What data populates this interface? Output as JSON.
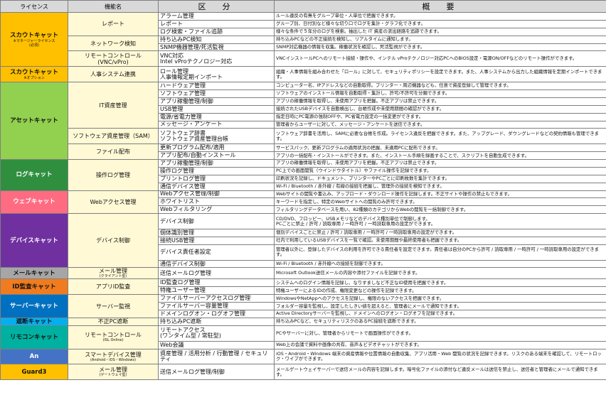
{
  "header": {
    "license": "ライセンス",
    "function": "機能名",
    "division": "区　分",
    "overview": "概　要"
  },
  "groups": [
    {
      "license": "スカウトキャット",
      "license_sub": "※マネージャーライセンス\n(必須)",
      "color": "#ffc000",
      "text_color": "#111111",
      "rows": [
        {
          "func": "レポート",
          "span": 3,
          "div": "アラーム管理",
          "ov": "ルール違反の有無をグループ単位・人単位で把握できます。"
        },
        {
          "div": "レポート",
          "ov": "グループ別、日付別など様々な切り口でログを集計・グラフ化できます。"
        },
        {
          "div": "ログ検索・ファイル追跡",
          "ov": "様々な条件で５年分のログを検索。抽出した IT 資産の流出経路を追跡できます。"
        },
        {
          "func": "ネットワーク検知",
          "span": 2,
          "div": "持ち込みPC検知",
          "ov": "持ち込みPCなどの不正接続を検知し、リアルタイムに通知します。"
        },
        {
          "div": "SNMP機器管理/死活監視",
          "ov": "SNMP対応機器の情報を収集。稼働状況を確認し、死活監視ができます。"
        },
        {
          "func": "リモートコントロール\n(VNC/vPro)",
          "span": 1,
          "div": "VNC対応\nIntel vProテクノロジー対応",
          "ov": "VNCインストールPCへのリモート接続・操作や、インテル vProテクノロジー対応PCへのBIOS設定・電源ON/OFFなどのリモート操作ができます。"
        }
      ]
    },
    {
      "license": "スカウトキャット",
      "license_sub": "※オプション",
      "color": "#ffc000",
      "text_color": "#111111",
      "rows": [
        {
          "func": "人事システム連携",
          "span": 1,
          "div": "ロール管理\n人事情報定期インポート",
          "ov": "組織・人事情報を組み合わせた「ロール」に対して、セキュリティポリシーを設定できます。また、人事システムから出力した組織情報を定期インポートできます。"
        }
      ]
    },
    {
      "license": "アセットキャット",
      "license_sub": "",
      "color": "#92d050",
      "text_color": "#111111",
      "rows": [
        {
          "func": "IT資産管理",
          "span": 6,
          "div": "ハードウェア管理",
          "ov": "コンピューター名、IPアドレスなどの自動取得。プリンター・周辺機器なども、任意で資産登録して管理できます。"
        },
        {
          "div": "ソフトウェア管理",
          "ov": "ソフトウェアのインストール情報を自動取得・集計し、許可/不許可を分類できます。"
        },
        {
          "div": "アプリ稼働管理/制御",
          "ov": "アプリの稼働情報を取得し、未使用アプリを把握。不正アプリは禁止できます。"
        },
        {
          "div": "USB管理",
          "ov": "接続されたUSBデバイスを自動検出し、台帳作成や未使用期間の確認ができます。"
        },
        {
          "div": "電源/省電力管理",
          "ov": "指定日時にPC電源の強制OFFや、PC省電力設定の一括変更ができます。"
        },
        {
          "div": "メッセージ・アンケート",
          "ov": "管理者からユーザーに対して、メッセージ・アンケートを送信できます。"
        },
        {
          "func": "ソフトウェア資産管理（SAM）",
          "span": 1,
          "div": "ソフトウェア辞書\nソフトウェア資産管理台帳",
          "ov": "ソフトウェア辞書を活用し、SAMに必要な台帳を作成。ライセンス違反を把握できます。また、アップグレード、ダウングレードなどの契約情報も管理できます。"
        },
        {
          "func": "ファイル配布",
          "span": 2,
          "div": "更新プログラム配布/適用",
          "ov": "サービスパック、更新プログラムの適用状況の把握、未適用PCに配布できます。"
        },
        {
          "div": "アプリ配布/自動インストール",
          "ov": "アプリの一括配布・インストールができます。また、インストール手順を録画することで、スクリプトを自動生成できます。"
        }
      ]
    },
    {
      "license": "ログキャット",
      "license_sub": "",
      "color": "#2f8f3f",
      "text_color": "#ffffff",
      "rows": [
        {
          "func": "操作ログ管理",
          "span": 4,
          "div": "アプリ稼働管理/制御",
          "ov": "アプリの稼働情報を取得し、未使用アプリを把握。不正アプリは禁止できます。"
        },
        {
          "div": "操作ログ管理",
          "ov": "PC上での画面閲覧（ウインドウタイトル）やファイル操作を記録できます。"
        },
        {
          "div": "プリントログ管理",
          "ov": "印刷状況を記録し、ドキュメント、プリンターやPCごとに印刷枚数を集計できます。"
        },
        {
          "div": "通信デバイス管理",
          "ov": "Wi-Fi / Bluetooth / 赤外線 / 有線の接続を把握し、管理外の接続を検知できます。"
        }
      ]
    },
    {
      "license": "ウェブキャット",
      "license_sub": "",
      "color": "#ff6b81",
      "text_color": "#ffffff",
      "rows": [
        {
          "func": "Webアクセス管理",
          "span": 3,
          "div": "Webアクセス管理/制御",
          "ov": "Webサイトの閲覧や書込み、アップロード・ダウンロード操作を記録します。不正サイトや操作の禁止もできます。"
        },
        {
          "div": "ホワイトリスト",
          "ov": "キーワードを指定し、特定のWebサイトへの閲覧のみ許可できます。"
        },
        {
          "div": "Webフィルタリング",
          "ov": "フィルタリングデータベースを用い、82種類のカテゴリからWebの閲覧を一括制御できます。"
        }
      ]
    },
    {
      "license": "デバイスキャット",
      "license_sub": "",
      "color": "#7030a0",
      "text_color": "#ffffff",
      "rows": [
        {
          "func": "デバイス制御",
          "span": 5,
          "div": "デバイス制御",
          "ov": "CD/DVD、フロッピー、USBメモリなどのデバイス種別単位で制御します。\nPCごとに禁止 / 許可 / 読取専用 / 一時許可 / 一時読取専用の設定ができます。"
        },
        {
          "div": "個体識別管理",
          "ov": "個別デバイスごとに禁止 / 許可 / 読取専用 / 一時許可 / 一時読取専用の設定ができます。"
        },
        {
          "div": "接続USB管理",
          "ov": "社内で利用しているUSBデバイスを一覧で確認。未使用期間や最終使用者も把握できます。"
        },
        {
          "div": "デバイス責任者設定",
          "ov": "管理者以外に、登録したデバイスの利用を許可できる責任者を設定できます。責任者は自分のPCから許可 / 読取専用 / 一時許可 / 一時読取専用の設定ができます。"
        },
        {
          "div": "通信デバイス制御",
          "ov": "Wi-Fi / Bluetooth / 赤外線への接続を制御できます。"
        }
      ]
    },
    {
      "license": "メールキャット",
      "license_sub": "",
      "color": "#a6a6a6",
      "text_color": "#111111",
      "rows": [
        {
          "func": "メール管理",
          "func_sub": "(クライアント型)",
          "span": 1,
          "div": "送信メールログ管理",
          "ov": "Microsoft Outlook送信メールの内容や添付ファイルを記録できます。"
        }
      ]
    },
    {
      "license": "ID監査キャット",
      "license_sub": "",
      "color": "#f07c1f",
      "text_color": "#111111",
      "rows": [
        {
          "func": "アプリID監査",
          "span": 2,
          "div": "ID監査ログ管理",
          "ov": "システムへのログイン情報を記録し、なりすましなど不正なID使用を把握できます。"
        },
        {
          "div": "特権ユーザー管理",
          "ov": "特権ユーザーによるIDの作成、権限変更などの操作を記録できます。"
        }
      ]
    },
    {
      "license": "サーバーキャット",
      "license_sub": "",
      "color": "#0070c0",
      "text_color": "#ffffff",
      "rows": [
        {
          "func": "サーバー監視",
          "span": 3,
          "div": "ファイルサーバーアクセスログ管理",
          "ov": "WindowsやNetAppへのアクセスを記録し、権限のないアクセスを把握できます。"
        },
        {
          "div": "ファイルサーバー容量管理",
          "ov": "フォルダー容量を監視し、設定したしきい値を超えると、管理者にメールで通知できます。"
        },
        {
          "div": "ドメインログオン・ログオフ管理",
          "ov": "Active Directoryサーバーを監視し、ドメインへのログオン・ログオフを記録できます。"
        }
      ]
    },
    {
      "license": "遮断キャット",
      "license_sub": "",
      "color": "#00b0f0",
      "text_color": "#111111",
      "rows": [
        {
          "func": "不正PC遮断",
          "span": 1,
          "div": "持ち込みPC遮断",
          "ov": "持ち込みPCなど、セキュリティリスクのあるPC接続を遮断できます。"
        }
      ]
    },
    {
      "license": "リモコンキャット",
      "license_sub": "",
      "color": "#00b0a0",
      "text_color": "#111111",
      "rows": [
        {
          "func": "リモートコントロール",
          "func_sub": "(ISL Online)",
          "span": 2,
          "div": "リモートアクセス\n(ワンタイム型 / 常駐型)",
          "ov": "PCやサーバーに対し、管理者からリモートで画面操作ができます。"
        },
        {
          "div": "Web会議",
          "ov": "Web上の会議で資料や画像の共有、音声＆ビデオチャットができます。"
        }
      ]
    },
    {
      "license": "An",
      "license_sub": "",
      "color": "#4472c4",
      "text_color": "#ffffff",
      "rows": [
        {
          "func": "スマートデバイス管理",
          "func_sub": "(Android・iOS・Windows)",
          "span": 1,
          "div": "資産管理 / 活用分析 / 行動管理 / セキュリティ",
          "ov": "iOS・Android・Windows 端末の資産情報や位置情報の自動収集、アプリ活用・Web 閲覧の状況を記録できます。リスクのある端末を確認して、リモートロック・ワイプができます。"
        }
      ]
    },
    {
      "license": "Guard3",
      "license_sub": "",
      "color": "#ffc000",
      "text_color": "#111111",
      "rows": [
        {
          "func": "メール管理",
          "func_sub": "(ゲートウェイ型)",
          "span": 1,
          "div": "送信メールログ管理/制御",
          "ov": "メールゲートウェイサーバーで送信メールの内容を記録します。暗号化ファイルの添付など違反メールは送信を禁止し、送信者と管理者にメールで通知できます。"
        }
      ]
    }
  ]
}
